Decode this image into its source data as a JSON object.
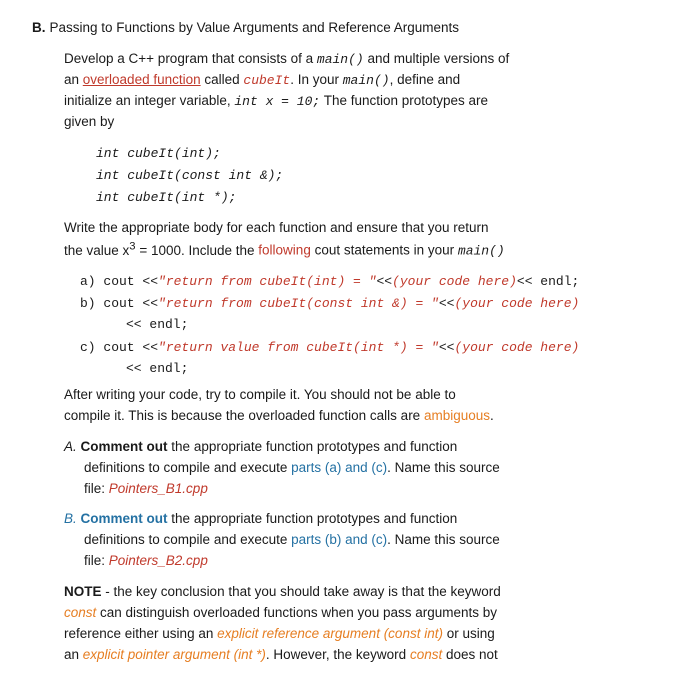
{
  "section": {
    "label": "B.",
    "heading": "Passing to Functions by Value Arguments and Reference Arguments",
    "para1_1": "Develop a C++ program that consists of a ",
    "main_func": "main()",
    "para1_2": " and multiple versions of",
    "para1_3": "an ",
    "overloaded_func": "overloaded function",
    "para1_4": " called ",
    "cubeIt_red": "cubeIt",
    "para1_5": ". In your ",
    "main_func2": "main()",
    "para1_6": ", define and",
    "para1_7": "initialize an integer variable, ",
    "int_x": "int x = 10;",
    "para1_8": " The function prototypes are",
    "para1_9": "given by",
    "code1": "int cubeIt(int);",
    "code2": "int cubeIt(const int &);",
    "code3": "int cubeIt(int *);",
    "para2_1": "Write the appropriate body for each function and ensure that you return",
    "para2_2": "the value x",
    "x3": "3",
    "para2_3": " = 1000. Include the ",
    "following_red": "following",
    "para2_4": " cout statements in your ",
    "main_func3": "main()",
    "list_a_pre": "a) ",
    "list_a_code1": "cout << ",
    "list_a_str1": "\"return from cubeIt(int) = \"",
    "list_a_code2": " << ",
    "list_a_your1": "(your code here)",
    "list_a_code3": " << endl;",
    "list_b_pre": "b) ",
    "list_b_code1": "cout << ",
    "list_b_str1": "\"return from cubeIt(const int &) = \"",
    "list_b_code2": " << ",
    "list_b_your1": "(your code here)",
    "list_b_code3": " << endl;",
    "list_c_pre": "c) ",
    "list_c_code1": "cout << ",
    "list_c_str1": "\"return value from cubeIt(int *) = \"",
    "list_c_code2": " << ",
    "list_c_your1": "(your code here)",
    "list_c_code3": " << endl;",
    "para3_1": "After writing your code, try to compile it. You should not be able to",
    "para3_2": "compile it. This is because the overloaded function calls are ",
    "ambiguous": "ambiguous",
    "para3_3": ".",
    "subA_label": "A.",
    "subA_comment": "Comment out",
    "subA_text1": " the appropriate function prototypes and function",
    "subA_text2": "definitions to compile and execute ",
    "subA_parts": "parts (a) and (c)",
    "subA_text3": ". Name this source",
    "subA_file1": "file: ",
    "subA_filename": "Pointers_B1.cpp",
    "subB_label": "B.",
    "subB_comment": "Comment out",
    "subB_text1": " the appropriate function prototypes and function",
    "subB_text2": "definitions to compile and execute ",
    "subB_parts": "parts (b) and (c)",
    "subB_text3": ". Name this source",
    "subB_file1": "file: ",
    "subB_filename": "Pointers_B2.cpp",
    "note_label": "NOTE",
    "note_text1": " - the key conclusion that you should take away is that the keyword",
    "note_const1": "const",
    "note_text2": " can distinguish overloaded functions when you pass arguments by",
    "note_text3": "reference either using an ",
    "note_explicit1": "explicit reference argument (",
    "note_const2": "const int",
    "note_explicit2": ") or using",
    "note_text4": "an ",
    "note_explicit3": "explicit pointer argument (",
    "note_int_star": "int *",
    "note_explicit4": "). However, the keyword ",
    "note_const3": "const",
    "note_text5": " does not"
  }
}
